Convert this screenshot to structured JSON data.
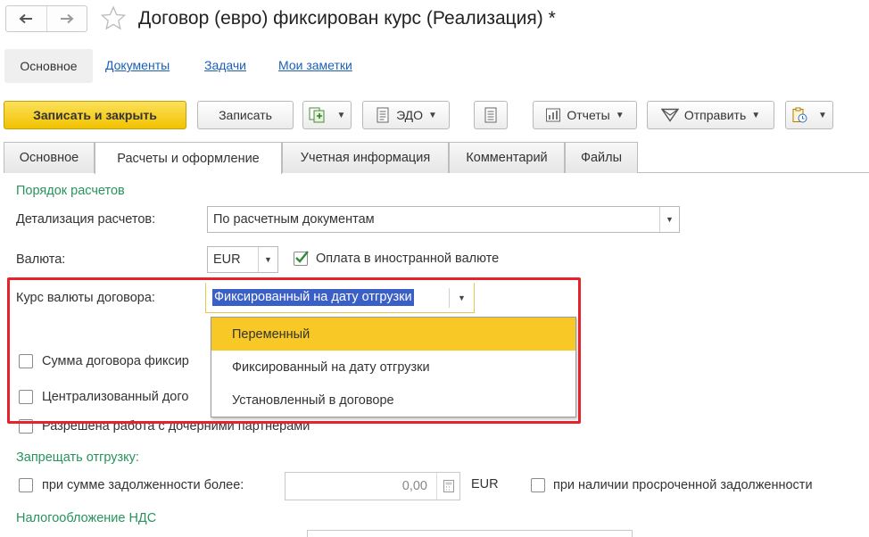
{
  "window": {
    "title": "Договор (евро) фиксирован курс (Реализация) *",
    "nav": {
      "back_icon": "arrow-left-icon",
      "forward_icon": "arrow-right-icon",
      "favorite_icon": "star-icon"
    }
  },
  "top_links": {
    "active": "Основное",
    "items": [
      "Документы",
      "Задачи",
      "Мои заметки"
    ]
  },
  "toolbar": {
    "save_close": "Записать и закрыть",
    "save": "Записать",
    "edo": "ЭДО",
    "reports": "Отчеты",
    "send": "Отправить"
  },
  "tabs": [
    "Основное",
    "Расчеты и оформление",
    "Учетная информация",
    "Комментарий",
    "Файлы"
  ],
  "active_tab": "Расчеты и оформление",
  "form": {
    "section_payment_order": "Порядок расчетов",
    "detail_label": "Детализация расчетов:",
    "detail_value": "По расчетным документам",
    "currency_label": "Валюта:",
    "currency_value": "EUR",
    "foreign_payment_label": "Оплата в иностранной валюте",
    "foreign_payment_checked": true,
    "rate_label": "Курс валюты договора:",
    "rate_value": "Фиксированный на дату отгрузки",
    "rate_options": [
      "Переменный",
      "Фиксированный на дату отгрузки",
      "Установленный в договоре"
    ],
    "rate_highlighted_option": "Переменный",
    "checkbox_fixed_sum": "Сумма договора фиксир",
    "checkbox_centralized": "Централизованный дого",
    "checkbox_subsidiaries": "Разрешена работа с дочерними партнерами",
    "section_prohibit": "Запрещать отгрузку:",
    "debt_more_label": "при сумме задолженности более:",
    "debt_amount": "0,00",
    "debt_currency": "EUR",
    "overdue_label": "при наличии просроченной задолженности",
    "section_vat": "Налогообложение НДС"
  },
  "colors": {
    "accent_green": "#27935c",
    "link_blue": "#1d5fb4",
    "primary_yellow": "#f2c200",
    "highlight_red": "#e8222a",
    "selection_blue": "#3a5fc7"
  }
}
